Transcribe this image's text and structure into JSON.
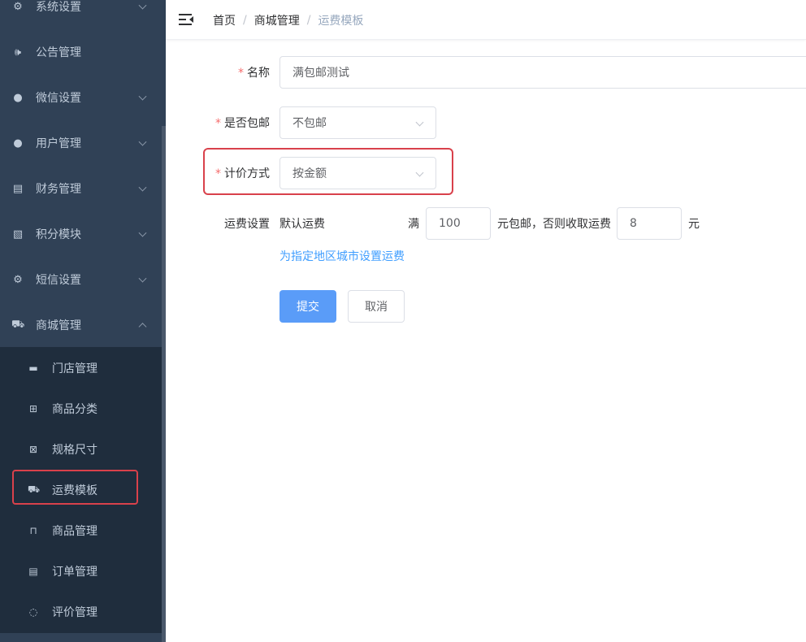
{
  "sidebar": {
    "items": [
      {
        "label": "系统设置",
        "icon": "gear-icon",
        "glyph": "⚙"
      },
      {
        "label": "公告管理",
        "icon": "speaker-icon",
        "glyph": "🕪"
      },
      {
        "label": "微信设置",
        "icon": "wechat-icon",
        "glyph": "●"
      },
      {
        "label": "用户管理",
        "icon": "user-icon",
        "glyph": "●"
      },
      {
        "label": "财务管理",
        "icon": "finance-icon",
        "glyph": "▤"
      },
      {
        "label": "积分模块",
        "icon": "points-icon",
        "glyph": "▧"
      },
      {
        "label": "短信设置",
        "icon": "sms-icon",
        "glyph": "⚙"
      },
      {
        "label": "商城管理",
        "icon": "cart-icon",
        "glyph": "⛟"
      }
    ],
    "submenu": [
      {
        "label": "门店管理",
        "icon": "store-icon",
        "glyph": "▬"
      },
      {
        "label": "商品分类",
        "icon": "grid-icon",
        "glyph": "⊞"
      },
      {
        "label": "规格尺寸",
        "icon": "size-icon",
        "glyph": "⊠"
      },
      {
        "label": "运费模板",
        "icon": "truck-icon",
        "glyph": "⛟"
      },
      {
        "label": "商品管理",
        "icon": "bag-icon",
        "glyph": "⊓"
      },
      {
        "label": "订单管理",
        "icon": "clipboard-icon",
        "glyph": "▤"
      },
      {
        "label": "评价管理",
        "icon": "comment-icon",
        "glyph": "◌"
      }
    ]
  },
  "header": {
    "breadcrumb": [
      "首页",
      "商城管理",
      "运费模板"
    ],
    "separator": "/"
  },
  "form": {
    "name_label": "名称",
    "name_value": "满包邮测试",
    "free_shipping_label": "是否包邮",
    "free_shipping_value": "不包邮",
    "pricing_label": "计价方式",
    "pricing_value": "按金额",
    "required_mark": "*",
    "fee_label": "运费设置",
    "default_fee_label": "默认运费",
    "full_label": "满",
    "threshold_value": "100",
    "free_text": "元包邮，否则收取运费",
    "fee_value": "8",
    "unit": "元",
    "region_link": "为指定地区城市设置运费",
    "submit_label": "提交",
    "cancel_label": "取消"
  },
  "colors": {
    "sidebar_bg": "#304156",
    "submenu_bg": "#1f2d3d",
    "primary": "#409eff",
    "highlight": "#d9414b"
  }
}
